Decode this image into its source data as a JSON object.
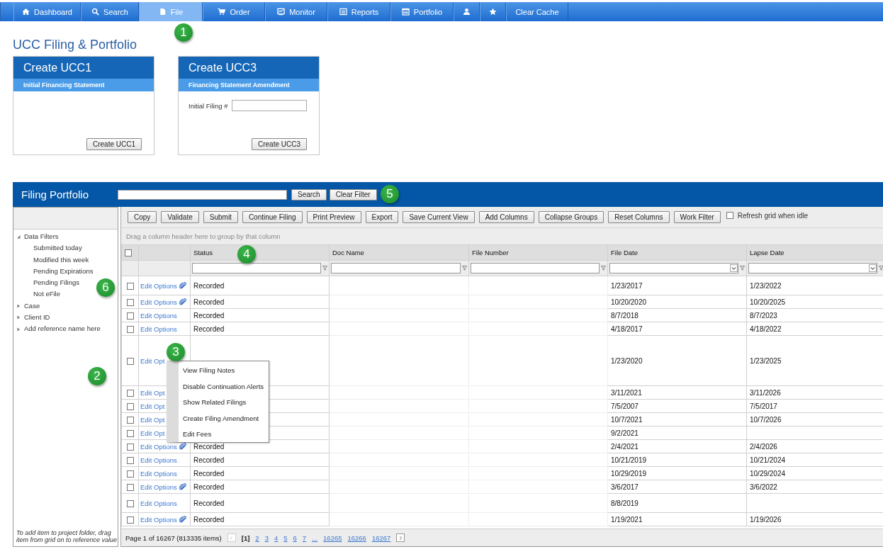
{
  "nav": [
    {
      "label": "Dashboard",
      "kind": "home",
      "selected": false
    },
    {
      "label": "Search",
      "kind": "search",
      "selected": false
    },
    {
      "label": "File",
      "kind": "file",
      "selected": true
    },
    {
      "label": "Order",
      "kind": "cart",
      "selected": false
    },
    {
      "label": "Monitor",
      "kind": "monitor",
      "selected": false
    },
    {
      "label": "Reports",
      "kind": "list",
      "selected": false
    },
    {
      "label": "Portfolio",
      "kind": "calendar",
      "selected": false
    },
    {
      "kind": "user",
      "selected": false
    },
    {
      "kind": "star",
      "selected": false
    },
    {
      "label": "Clear Cache",
      "selected": false
    }
  ],
  "page_title": "UCC Filing & Portfolio",
  "cards": [
    {
      "title": "Create UCC1",
      "subtitle": "Initial Financing Statement",
      "button": "Create UCC1"
    },
    {
      "title": "Create UCC3",
      "subtitle": "Financing Statement Amendment",
      "field_label": "Initial Filing #",
      "button": "Create UCC3"
    }
  ],
  "portfolio": {
    "title": "Filing Portfolio",
    "search_buttons": [
      "Search",
      "Clear Filter"
    ],
    "tree": [
      {
        "label": "Data Filters",
        "expanded": true,
        "children": [
          {
            "label": "Submitted today"
          },
          {
            "label": "Modified this week"
          },
          {
            "label": "Pending Expirations"
          },
          {
            "label": "Pending Filings"
          },
          {
            "label": "Not eFile"
          }
        ]
      },
      {
        "label": "Case",
        "expanded": false
      },
      {
        "label": "Client ID",
        "expanded": false
      },
      {
        "label": "Add reference name here",
        "expanded": false
      }
    ],
    "note": "To add item to project folder, drag item from grid on to reference value",
    "toolbar": [
      "Copy",
      "Validate",
      "Submit",
      "Continue Filing",
      "Print Preview",
      "Export",
      "Save Current View",
      "Add Columns",
      "Collapse Groups",
      "Reset Columns",
      "Work Filter"
    ],
    "refresh": {
      "label": "Refresh grid when idle",
      "checked": false
    },
    "group_hint": "Drag a column header here to group by that column",
    "select_all": {
      "checked": false
    },
    "columns": [
      {
        "label": "Status",
        "kind": "text"
      },
      {
        "label": "Doc Name",
        "kind": "text"
      },
      {
        "label": "File Number",
        "kind": "text"
      },
      {
        "label": "File Date",
        "kind": "dropdown"
      },
      {
        "label": "Lapse Date",
        "kind": "dropdown"
      }
    ],
    "rows": [
      {
        "kind": "tall",
        "checked": false,
        "link": "Edit Options",
        "attachment": true,
        "status": "Recorded",
        "file_date": "1/23/2017",
        "lapse_date": "1/23/2022"
      },
      {
        "kind": "normal",
        "checked": false,
        "link": "Edit Options",
        "attachment": true,
        "status": "Recorded",
        "file_date": "10/20/2020",
        "lapse_date": "10/20/2025"
      },
      {
        "kind": "normal",
        "checked": false,
        "link": "Edit Options",
        "attachment": false,
        "status": "Recorded",
        "file_date": "8/7/2018",
        "lapse_date": "8/7/2023"
      },
      {
        "kind": "normal",
        "checked": false,
        "link": "Edit Options",
        "attachment": false,
        "status": "Recorded",
        "file_date": "4/18/2017",
        "lapse_date": "4/18/2022"
      },
      {
        "kind": "multi",
        "checked": false,
        "link": "Edit Opt",
        "attachment": false,
        "file_date": "1/23/2020",
        "lapse_date": "1/23/2025"
      },
      {
        "kind": "normal",
        "checked": false,
        "link": "Edit Opt",
        "attachment": false,
        "file_date": "3/11/2021",
        "lapse_date": "3/11/2026"
      },
      {
        "kind": "normal",
        "checked": false,
        "link": "Edit Opt",
        "attachment": false,
        "file_date": "7/5/2007",
        "lapse_date": "7/5/2017"
      },
      {
        "kind": "normal",
        "checked": false,
        "link": "Edit Opt",
        "attachment": false,
        "file_date": "10/7/2021",
        "lapse_date": "10/7/2026"
      },
      {
        "kind": "normal",
        "checked": false,
        "link": "Edit Opt",
        "attachment": false,
        "file_date": "9/2/2021"
      },
      {
        "kind": "normal",
        "checked": false,
        "link": "Edit Options",
        "attachment": true,
        "status": "Recorded",
        "file_date": "2/4/2021",
        "lapse_date": "2/4/2026"
      },
      {
        "kind": "normal",
        "checked": false,
        "link": "Edit Options",
        "attachment": false,
        "status": "Recorded",
        "file_date": "10/21/2019",
        "lapse_date": "10/21/2024"
      },
      {
        "kind": "normal",
        "checked": false,
        "link": "Edit Options",
        "attachment": false,
        "status": "Recorded",
        "file_date": "10/29/2019",
        "lapse_date": "10/29/2024"
      },
      {
        "kind": "normal",
        "checked": false,
        "link": "Edit Options",
        "attachment": true,
        "status": "Recorded",
        "file_date": "3/6/2017",
        "lapse_date": "3/6/2022"
      },
      {
        "kind": "tall",
        "checked": false,
        "link": "Edit Options",
        "attachment": false,
        "status": "Recorded",
        "file_date": "8/8/2019"
      },
      {
        "kind": "normal",
        "checked": false,
        "link": "Edit Options",
        "attachment": true,
        "status": "Recorded",
        "file_date": "1/19/2021",
        "lapse_date": "1/19/2026"
      }
    ],
    "pager": {
      "summary": "Page 1 of 16267 (813335 items)",
      "pages": [
        {
          "label": "[1]",
          "selected": true
        },
        {
          "label": "2",
          "selected": false
        },
        {
          "label": "3",
          "selected": false
        },
        {
          "label": "4",
          "selected": false
        },
        {
          "label": "5",
          "selected": false
        },
        {
          "label": "6",
          "selected": false
        },
        {
          "label": "7",
          "selected": false
        },
        {
          "label": "...",
          "selected": false
        },
        {
          "label": "16265",
          "selected": false
        },
        {
          "label": "16266",
          "selected": false
        },
        {
          "label": "16267",
          "selected": false
        }
      ]
    },
    "context_menu": [
      "View Filing Notes",
      "Disable Continuation Alerts",
      "Show Related Filings",
      "Create Filing Amendment",
      "Edit Fees"
    ]
  },
  "callouts": [
    "1",
    "2",
    "3",
    "4",
    "5",
    "6"
  ]
}
